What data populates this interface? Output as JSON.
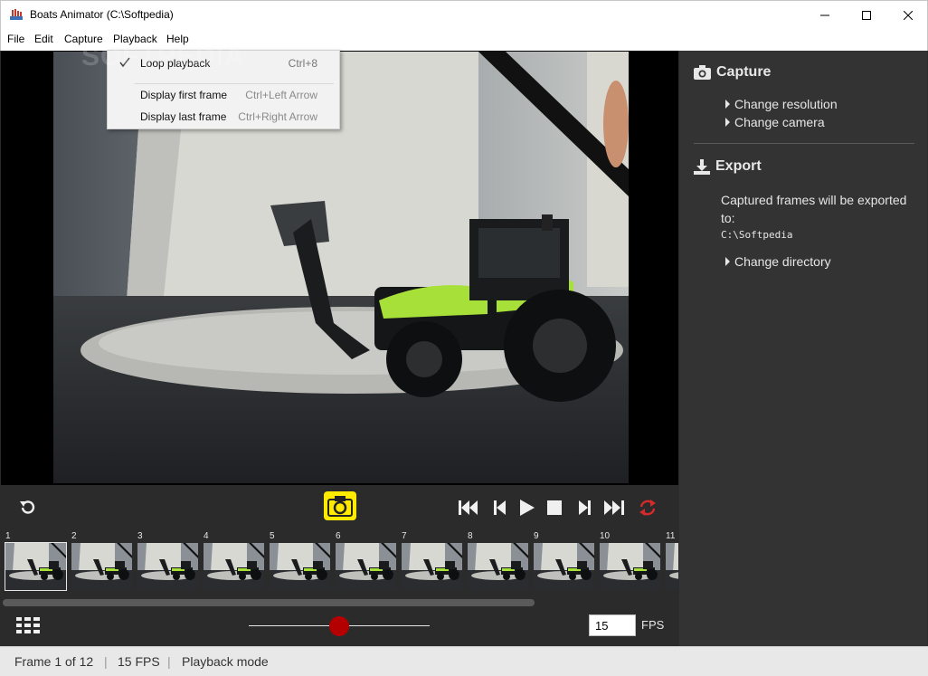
{
  "window": {
    "title": "Boats Animator (C:\\Softpedia)"
  },
  "menu": {
    "file": "File",
    "edit": "Edit",
    "capture": "Capture",
    "playback": "Playback",
    "help": "Help"
  },
  "playback_menu": {
    "items": [
      {
        "label": "Loop playback",
        "shortcut": "Ctrl+8",
        "checked": true
      },
      {
        "label": "Display first frame",
        "shortcut": "Ctrl+Left Arrow"
      },
      {
        "label": "Display last frame",
        "shortcut": "Ctrl+Right Arrow"
      }
    ]
  },
  "watermark": "SOFTPEDIA",
  "side_panel": {
    "capture": {
      "heading": "Capture",
      "links": [
        "Change resolution",
        "Change camera"
      ]
    },
    "export": {
      "heading": "Export",
      "description": "Captured frames will be exported to:",
      "path": "C:\\Softpedia",
      "link": "Change directory"
    }
  },
  "timeline": {
    "frames": [
      "1",
      "2",
      "3",
      "4",
      "5",
      "6",
      "7",
      "8",
      "9",
      "10",
      "11"
    ],
    "selected_index": 0
  },
  "playback": {
    "fps_value": "15",
    "fps_label": "FPS",
    "speed_fraction": 0.5
  },
  "status": {
    "frame": "Frame 1 of 12",
    "fps": "15 FPS",
    "mode": "Playback mode"
  },
  "colors": {
    "accent_yellow": "#ffea00",
    "record_red": "#b40000",
    "loop_red": "#d42a2a",
    "check": "#444444"
  }
}
